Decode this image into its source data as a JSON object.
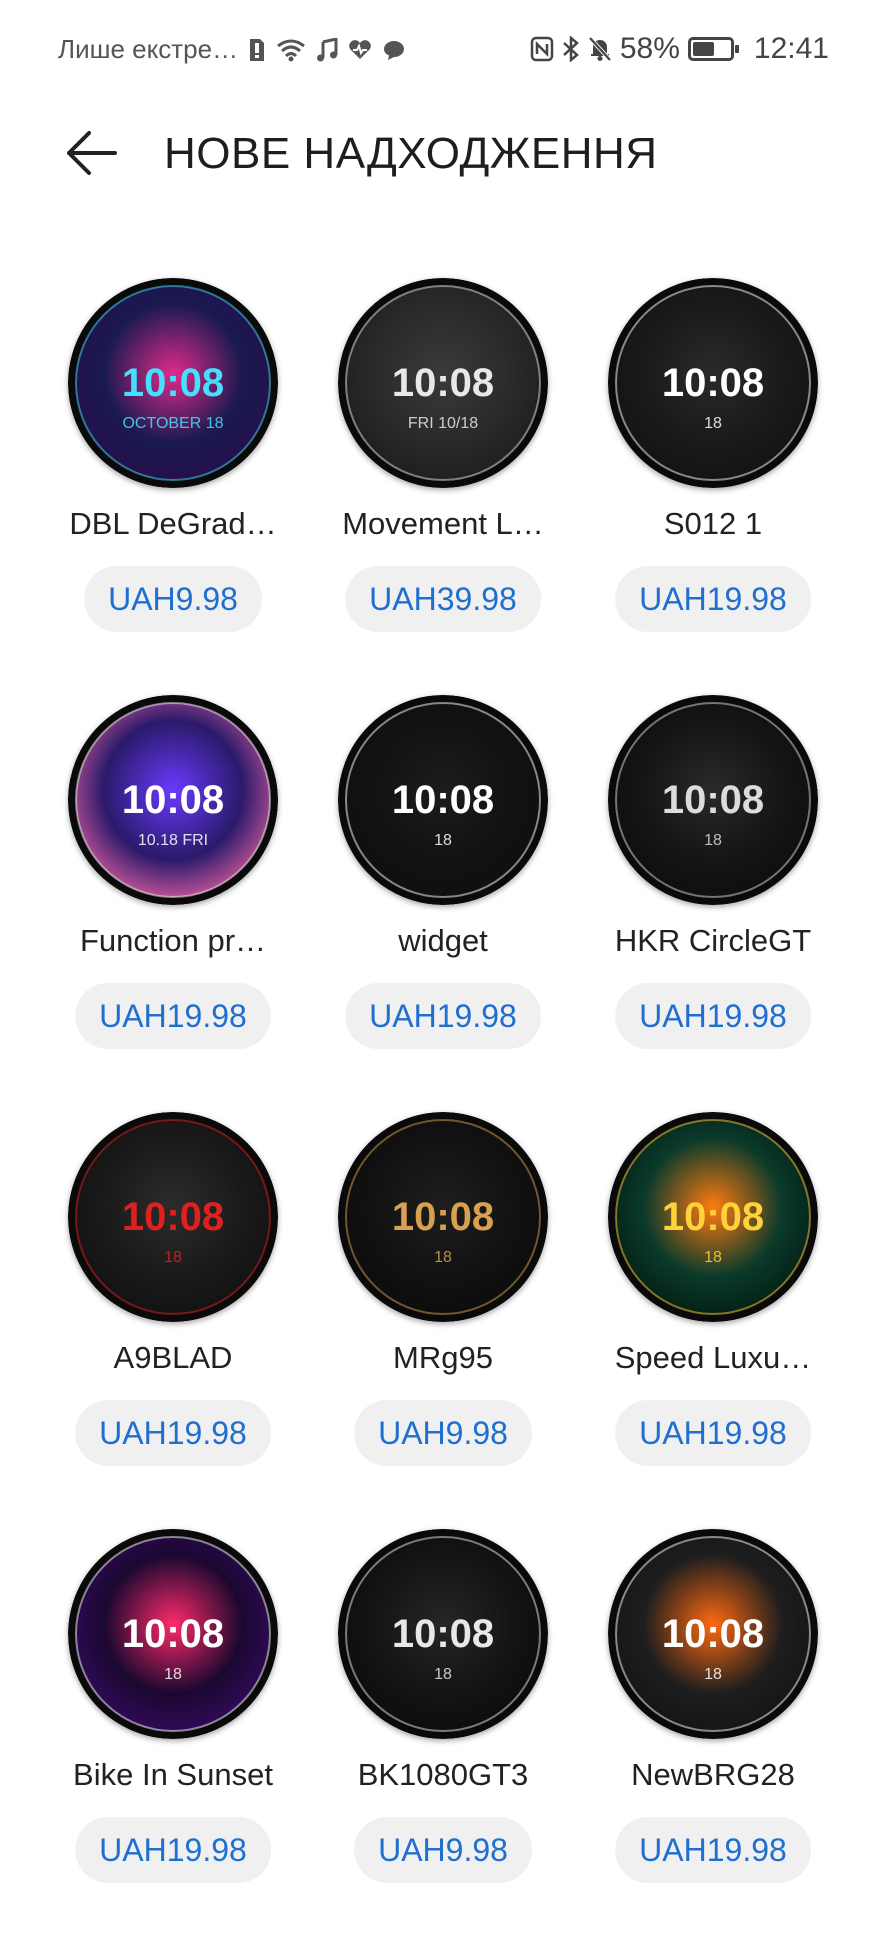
{
  "status_bar": {
    "notification_text": "Лише екстре…",
    "battery_percent": "58%",
    "battery_level": 0.58,
    "time": "12:41",
    "left_icons": [
      "sim-icon",
      "wifi-icon",
      "music-icon",
      "health-icon",
      "message-icon"
    ],
    "right_icons": [
      "nfc-icon",
      "bluetooth-icon",
      "mute-icon"
    ]
  },
  "header": {
    "title": "НОВЕ НАДХОДЖЕННЯ",
    "back_icon": "arrow-left-icon"
  },
  "watch_faces": [
    {
      "name": "DBL DeGrad…",
      "price": "UAH9.98",
      "face": {
        "time": "10:08",
        "date": "OCTOBER 18",
        "colors": [
          "#2a0a4a",
          "#e02a8a",
          "#1a1a50"
        ],
        "accent": "#46e0ff"
      }
    },
    {
      "name": "Movement L…",
      "price": "UAH39.98",
      "face": {
        "time": "10:08",
        "date": "FRI 10/18",
        "colors": [
          "#1a1a1a",
          "#3a3a3a",
          "#2a2a2a"
        ],
        "accent": "#e8e8e8"
      }
    },
    {
      "name": "S012 1",
      "price": "UAH19.98",
      "face": {
        "time": "10:08",
        "date": "18",
        "colors": [
          "#111111",
          "#2a2a2a",
          "#1a1a1a"
        ],
        "accent": "#ffffff"
      }
    },
    {
      "name": "Function pr…",
      "price": "UAH19.98",
      "face": {
        "time": "10:08",
        "date": "10.18 FRI",
        "colors": [
          "#ff6aa8",
          "#6a3aff",
          "#2a1a6a"
        ],
        "accent": "#ffffff"
      }
    },
    {
      "name": "widget",
      "price": "UAH19.98",
      "face": {
        "time": "10:08",
        "date": "18",
        "colors": [
          "#0e0e0e",
          "#1c1c1c",
          "#121212"
        ],
        "accent": "#ffffff"
      }
    },
    {
      "name": "HKR CircleGT",
      "price": "UAH19.98",
      "face": {
        "time": "10:08",
        "date": "18",
        "colors": [
          "#0c0c0c",
          "#2a2a2a",
          "#151515"
        ],
        "accent": "#dcdcdc"
      }
    },
    {
      "name": "A9BLAD",
      "price": "UAH19.98",
      "face": {
        "time": "10:08",
        "date": "18",
        "colors": [
          "#101010",
          "#2c2c2c",
          "#1a1a1a"
        ],
        "accent": "#e02020"
      }
    },
    {
      "name": "MRg95",
      "price": "UAH9.98",
      "face": {
        "time": "10:08",
        "date": "18",
        "colors": [
          "#0a0a0a",
          "#1e1e1e",
          "#121212"
        ],
        "accent": "#d8a050"
      }
    },
    {
      "name": "Speed Luxu…",
      "price": "UAH19.98",
      "face": {
        "time": "10:08",
        "date": "18",
        "colors": [
          "#02160e",
          "#ff7a10",
          "#0a3a2a"
        ],
        "accent": "#ffd23a"
      }
    },
    {
      "name": "Bike In Sunset",
      "price": "UAH19.98",
      "face": {
        "time": "10:08",
        "date": "18",
        "colors": [
          "#3a0a6a",
          "#ff2a6a",
          "#1a0830"
        ],
        "accent": "#ffffff"
      }
    },
    {
      "name": "BK1080GT3",
      "price": "UAH9.98",
      "face": {
        "time": "10:08",
        "date": "18",
        "colors": [
          "#0a0a0a",
          "#262626",
          "#141414"
        ],
        "accent": "#e8e8e8"
      }
    },
    {
      "name": "NewBRG28",
      "price": "UAH19.98",
      "face": {
        "time": "10:08",
        "date": "18",
        "colors": [
          "#111111",
          "#ff6a10",
          "#1e1e1e"
        ],
        "accent": "#ffffff"
      }
    }
  ]
}
